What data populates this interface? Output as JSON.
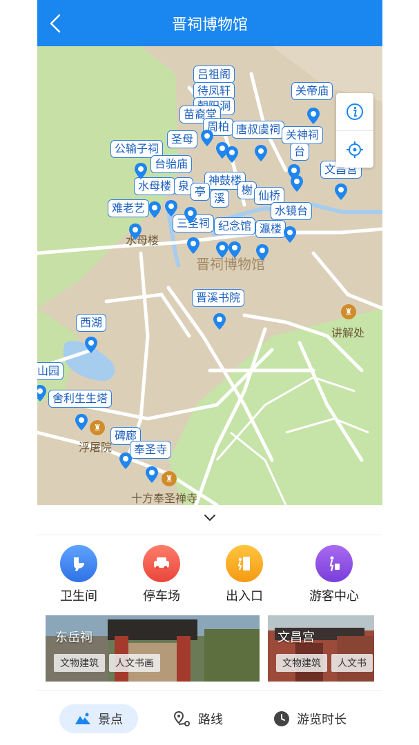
{
  "header": {
    "title": "晋祠博物馆"
  },
  "map": {
    "area_name": "晋祠博物馆",
    "labels": [
      {
        "text": "吕祖阁"
      },
      {
        "text": "待凤轩"
      },
      {
        "text": "朝阳洞"
      },
      {
        "text": "苗裔堂"
      },
      {
        "text": "关帝庙"
      },
      {
        "text": "周柏"
      },
      {
        "text": "唐叔虞祠"
      },
      {
        "text": "关神祠"
      },
      {
        "text": "圣母"
      },
      {
        "text": "公输子祠"
      },
      {
        "text": "台骀庙"
      },
      {
        "text": "台"
      },
      {
        "text": "文昌宫"
      },
      {
        "text": "神鼓楼"
      },
      {
        "text": "水母楼"
      },
      {
        "text": "泉"
      },
      {
        "text": "亭"
      },
      {
        "text": "溪"
      },
      {
        "text": "榭"
      },
      {
        "text": "仙桥"
      },
      {
        "text": "难老艺"
      },
      {
        "text": "水镜台"
      },
      {
        "text": "三圣祠"
      },
      {
        "text": "纪念馆"
      },
      {
        "text": "瀛楼"
      },
      {
        "text": "晋溪书院"
      },
      {
        "text": "西湖"
      },
      {
        "text": "山园"
      },
      {
        "text": "舍利生生塔"
      },
      {
        "text": "碑廊"
      },
      {
        "text": "奉圣寺"
      }
    ],
    "places": [
      {
        "text": "水母楼"
      },
      {
        "text": "讲解处"
      },
      {
        "text": "浮屠院"
      },
      {
        "text": "十方奉圣禅寺"
      }
    ]
  },
  "categories": [
    {
      "label": "卫生间",
      "color": "#3f86f0"
    },
    {
      "label": "停车场",
      "color": "#f0604c"
    },
    {
      "label": "出入口",
      "color": "#f5a623"
    },
    {
      "label": "游客中心",
      "color": "#8b4fe0"
    }
  ],
  "cards": [
    {
      "title": "东岳祠",
      "tags": [
        "文物建筑",
        "人文书画"
      ]
    },
    {
      "title": "文昌宫",
      "tags": [
        "文物建筑",
        "人文书"
      ]
    }
  ],
  "tabs": [
    {
      "label": "景点",
      "active": true
    },
    {
      "label": "路线",
      "active": false
    },
    {
      "label": "游览时长",
      "active": false
    }
  ],
  "colors": {
    "primary": "#1a86f0"
  }
}
